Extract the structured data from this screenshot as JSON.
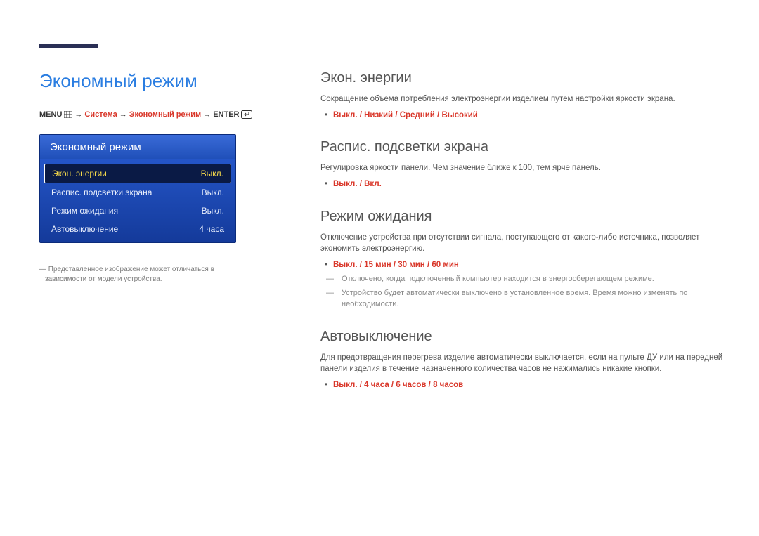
{
  "page_title": "Экономный режим",
  "menu_path": {
    "menu_label": "MENU",
    "arrow": "→",
    "seg1": "Система",
    "seg2": "Экономный режим",
    "enter_label": "ENTER"
  },
  "osd": {
    "header": "Экономный режим",
    "rows": [
      {
        "label": "Экон. энергии",
        "value": "Выкл.",
        "selected": true
      },
      {
        "label": "Распис. подсветки экрана",
        "value": "Выкл.",
        "selected": false
      },
      {
        "label": "Режим ожидания",
        "value": "Выкл.",
        "selected": false
      },
      {
        "label": "Автовыключение",
        "value": "4 часа",
        "selected": false
      }
    ]
  },
  "caption": "― Представленное изображение может отличаться в зависимости от модели устройства.",
  "sections": {
    "energy": {
      "title": "Экон. энергии",
      "desc": "Сокращение объема потребления электроэнергии изделием путем настройки яркости экрана.",
      "options": [
        "Выкл.",
        "Низкий",
        "Средний",
        "Высокий"
      ]
    },
    "backlight": {
      "title": "Распис. подсветки экрана",
      "desc": "Регулировка яркости панели. Чем значение ближе к 100, тем ярче панель.",
      "options": [
        "Выкл.",
        "Вкл."
      ]
    },
    "standby": {
      "title": "Режим ожидания",
      "desc": "Отключение устройства при отсутствии сигнала, поступающего от какого-либо источника, позволяет экономить электроэнергию.",
      "options": [
        "Выкл.",
        "15 мин",
        "30 мин",
        "60 мин"
      ],
      "notes": [
        "Отключено, когда подключенный компьютер находится в энергосберегающем режиме.",
        "Устройство будет автоматически выключено в установленное время. Время можно изменять по необходимости."
      ]
    },
    "autooff": {
      "title": "Автовыключение",
      "desc": "Для предотвращения перегрева изделие автоматически выключается, если на пульте ДУ или на передней панели изделия в течение назначенного количества часов не нажимались никакие кнопки.",
      "options": [
        "Выкл.",
        "4 часа",
        "6 часов",
        "8 часов"
      ]
    }
  }
}
